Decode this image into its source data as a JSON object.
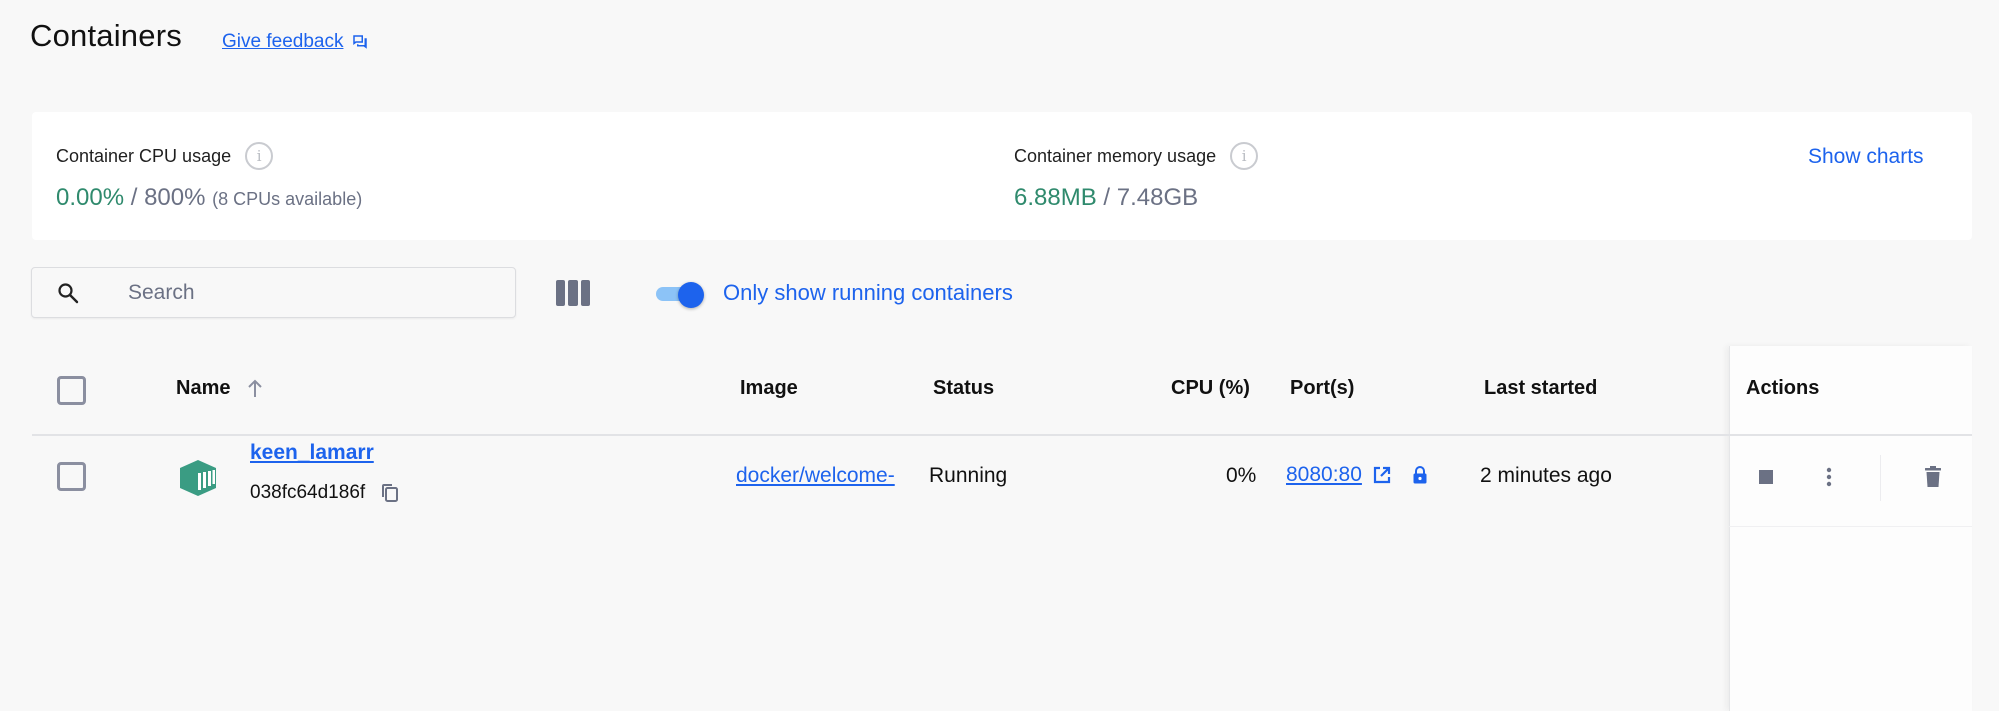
{
  "header": {
    "title": "Containers",
    "feedback_label": "Give feedback",
    "feedback_icon": "feedback-icon"
  },
  "stats": {
    "cpu": {
      "label": "Container CPU usage",
      "used": "0.00%",
      "separator": " / ",
      "total": "800%",
      "note": "(8 CPUs available)",
      "info_icon": "info-icon"
    },
    "memory": {
      "label": "Container memory usage",
      "used": "6.88MB",
      "separator": " / ",
      "total": "7.48GB",
      "info_icon": "info-icon"
    },
    "show_charts_label": "Show charts"
  },
  "toolbar": {
    "search": {
      "value": "",
      "placeholder": "Search",
      "icon": "search-icon"
    },
    "columns_icon": "columns-icon",
    "running_toggle": {
      "label": "Only show running containers",
      "checked": true
    }
  },
  "table": {
    "columns": {
      "name": "Name",
      "image": "Image",
      "status": "Status",
      "cpu": "CPU (%)",
      "ports": "Port(s)",
      "last_started": "Last started",
      "actions": "Actions"
    },
    "sort": {
      "column": "Name",
      "direction": "ascending",
      "icon": "arrow-up-icon"
    },
    "rows": [
      {
        "selected": false,
        "icon": "container-icon",
        "name": "keen_lamarr",
        "id": "038fc64d186f",
        "image": "docker/welcome-",
        "status": "Running",
        "cpu": "0%",
        "ports": "8080:80",
        "last_started": "2 minutes ago",
        "actions": [
          "stop",
          "more",
          "delete"
        ]
      }
    ]
  },
  "colors": {
    "accent": "#1d63ed",
    "green": "#2f8a6d",
    "muted": "#6b7184",
    "background": "#f8f8f8",
    "card": "#ffffff"
  }
}
